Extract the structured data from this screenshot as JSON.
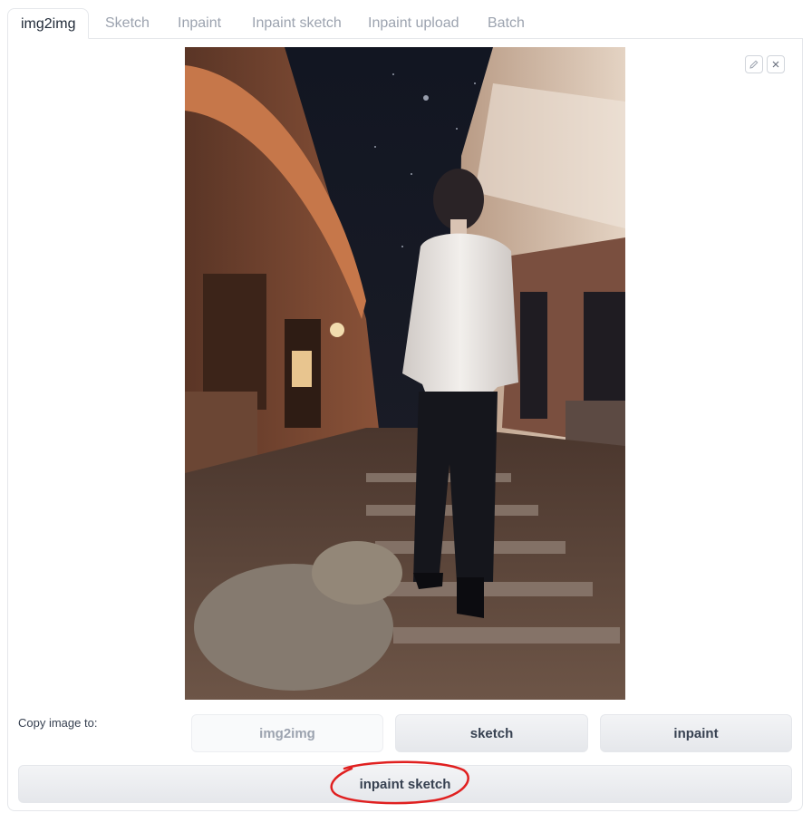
{
  "tabs": [
    {
      "label": "img2img",
      "active": true
    },
    {
      "label": "Sketch",
      "active": false
    },
    {
      "label": "Inpaint",
      "active": false
    },
    {
      "label": "Inpaint sketch",
      "active": false
    },
    {
      "label": "Inpaint upload",
      "active": false
    },
    {
      "label": "Batch",
      "active": false
    }
  ],
  "image_tools": {
    "edit_icon": "pencil-icon",
    "clear_icon": "close-icon"
  },
  "copy": {
    "label": "Copy image to:",
    "buttons": {
      "img2img": "img2img",
      "sketch": "sketch",
      "inpaint": "inpaint",
      "inpaint_sketch": "inpaint sketch"
    }
  },
  "colors": {
    "annotation": "#e02020",
    "active_tab_text": "#1f2937",
    "inactive_tab_text": "#9ca3af"
  }
}
